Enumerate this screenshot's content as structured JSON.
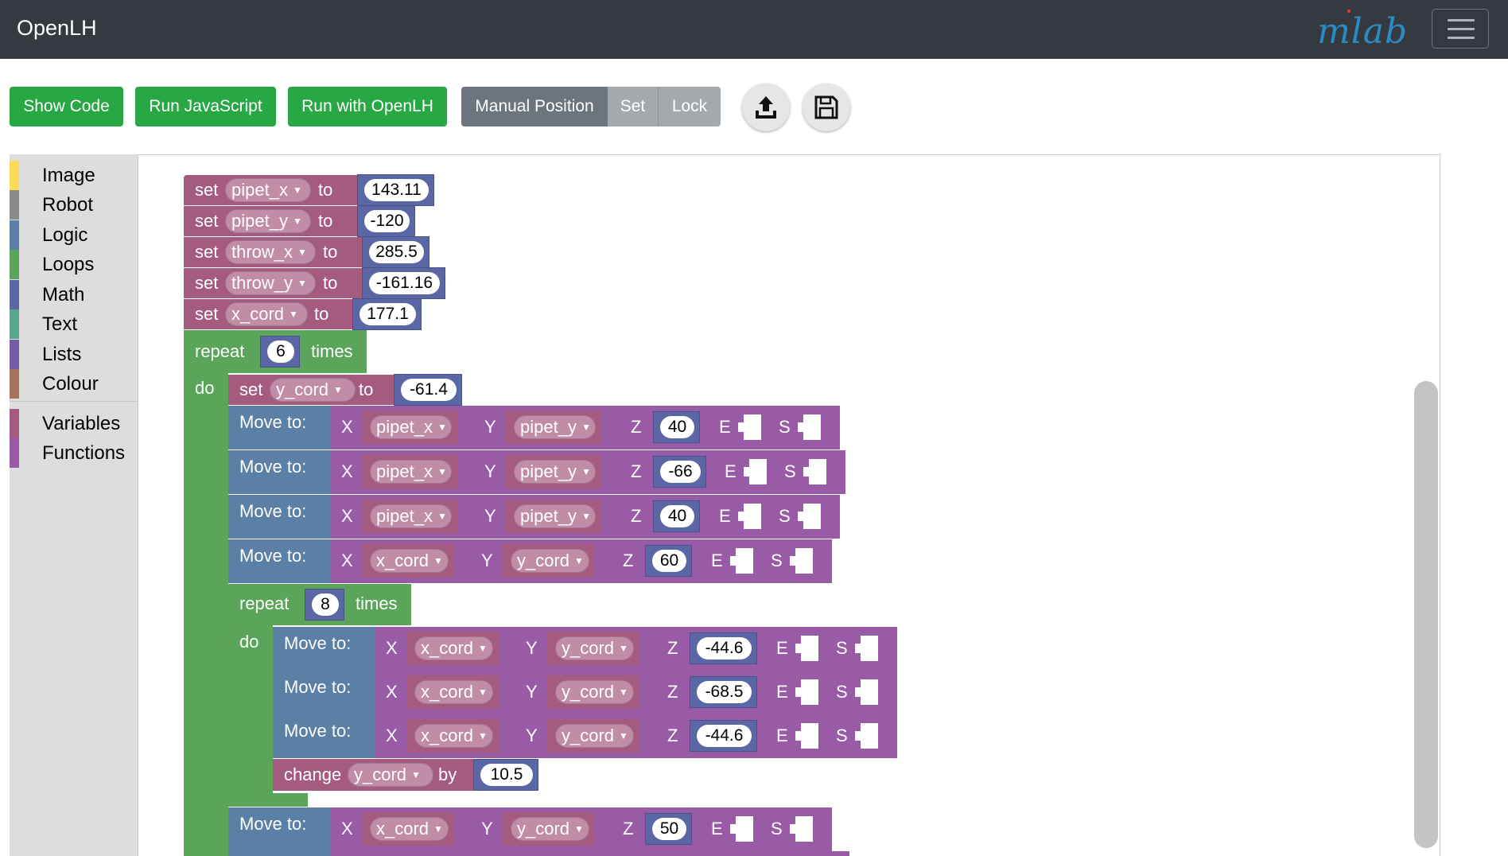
{
  "app": {
    "title": "OpenLH",
    "logo_text": "mlab"
  },
  "toolbar": {
    "show_code": "Show Code",
    "run_js": "Run JavaScript",
    "run_openlh": "Run with OpenLH",
    "manual_position": "Manual Position",
    "set": "Set",
    "lock": "Lock",
    "upload_icon": "upload-icon",
    "save_icon": "floppy-disk-icon"
  },
  "toolbox": {
    "categories": [
      {
        "label": "Image",
        "color": "#fdda59"
      },
      {
        "label": "Robot",
        "color": "#8a8a8a"
      },
      {
        "label": "Logic",
        "color": "#5b80a5"
      },
      {
        "label": "Loops",
        "color": "#5ba55b"
      },
      {
        "label": "Math",
        "color": "#5b67a5"
      },
      {
        "label": "Text",
        "color": "#5ba58c"
      },
      {
        "label": "Lists",
        "color": "#745ba5"
      },
      {
        "label": "Colour",
        "color": "#a5745b"
      },
      {
        "label": "Variables",
        "color": "#a55b80"
      },
      {
        "label": "Functions",
        "color": "#995ba5"
      }
    ]
  },
  "blocks": {
    "kw": {
      "set": "set",
      "to": "to",
      "repeat": "repeat",
      "times": "times",
      "do": "do",
      "move": "Move to:",
      "change": "change",
      "by": "by",
      "X": "X",
      "Y": "Y",
      "Z": "Z",
      "E": "E",
      "S": "S"
    },
    "sets": [
      {
        "var": "pipet_x",
        "value": "143.11"
      },
      {
        "var": "pipet_y",
        "value": "-120"
      },
      {
        "var": "throw_x",
        "value": "285.5"
      },
      {
        "var": "throw_y",
        "value": "-161.16"
      },
      {
        "var": "x_cord",
        "value": "177.1"
      }
    ],
    "repeat_outer": "6",
    "inner_set": {
      "var": "y_cord",
      "value": "-61.4"
    },
    "moves_a": [
      {
        "x": "pipet_x",
        "y": "pipet_y",
        "z": "40"
      },
      {
        "x": "pipet_x",
        "y": "pipet_y",
        "z": "-66"
      },
      {
        "x": "pipet_x",
        "y": "pipet_y",
        "z": "40"
      },
      {
        "x": "x_cord",
        "y": "y_cord",
        "z": "60"
      }
    ],
    "repeat_inner": "8",
    "moves_b": [
      {
        "x": "x_cord",
        "y": "y_cord",
        "z": "-44.6"
      },
      {
        "x": "x_cord",
        "y": "y_cord",
        "z": "-68.5"
      },
      {
        "x": "x_cord",
        "y": "y_cord",
        "z": "-44.6"
      }
    ],
    "change": {
      "var": "y_cord",
      "value": "10.5"
    },
    "move_last": {
      "x": "x_cord",
      "y": "y_cord",
      "z": "50"
    }
  }
}
